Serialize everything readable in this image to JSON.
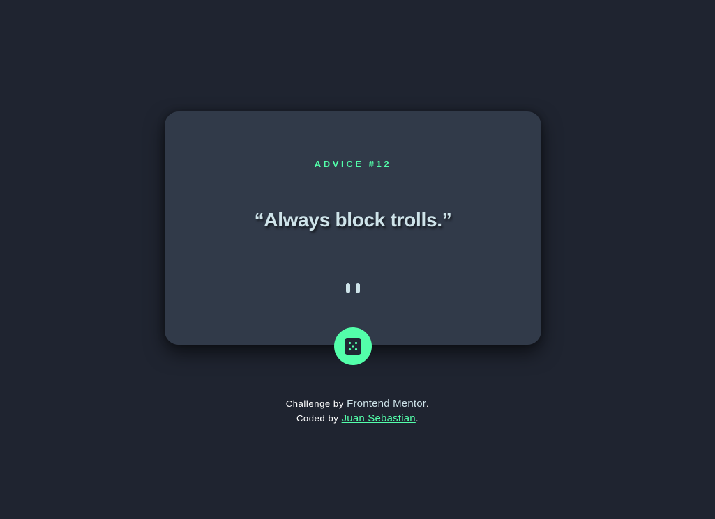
{
  "card": {
    "advice_label": "ADVICE #12",
    "advice_text": "“Always block trolls.”"
  },
  "icons": {
    "divider": "pause-icon",
    "generate": "dice-icon"
  },
  "footer": {
    "challenge_prefix": "Challenge by ",
    "challenge_link": "Frontend Mentor",
    "challenge_suffix": ".",
    "coded_prefix": "Coded by ",
    "coded_link": "Juan Sebastian",
    "coded_suffix": "."
  },
  "colors": {
    "background": "#1f2430",
    "card": "#313a49",
    "accent": "#53ffaa",
    "text": "#cee3e9",
    "divider_line": "#4f5d74"
  }
}
